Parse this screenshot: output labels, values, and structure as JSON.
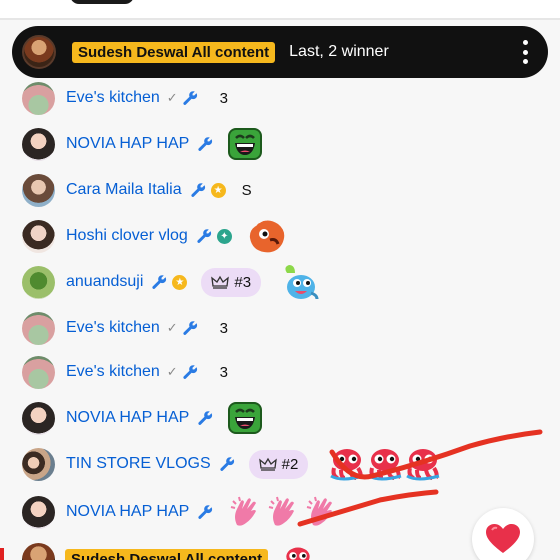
{
  "pinned": {
    "badge": "Sudesh Deswal All content",
    "text": "Last, 2 winner"
  },
  "messages": [
    {
      "author": "Eve's kitchen",
      "verified": true,
      "moderator": true,
      "member": null,
      "text": "3",
      "rank": null,
      "emote": null
    },
    {
      "author": "NOVIA HAP HAP",
      "verified": false,
      "moderator": true,
      "member": null,
      "text": "",
      "rank": null,
      "emote": "green-laughing-face-emote"
    },
    {
      "author": "Cara Maila Italia",
      "verified": false,
      "moderator": true,
      "member": "gold-member-badge",
      "text": "S",
      "rank": null,
      "emote": null
    },
    {
      "author": "Hoshi clover vlog",
      "verified": false,
      "moderator": true,
      "member": "teal-member-badge",
      "text": "",
      "rank": null,
      "emote": "orange-blob-emote"
    },
    {
      "author": "anuandsuji",
      "verified": false,
      "moderator": true,
      "member": "gold-member-badge",
      "text": "",
      "rank": "#3",
      "emote": "blue-dancing-emote"
    },
    {
      "author": "Eve's kitchen",
      "verified": true,
      "moderator": true,
      "member": null,
      "text": "3",
      "rank": null,
      "emote": null
    },
    {
      "author": "Eve's kitchen",
      "verified": true,
      "moderator": true,
      "member": null,
      "text": "3",
      "rank": null,
      "emote": null
    },
    {
      "author": "NOVIA HAP HAP",
      "verified": false,
      "moderator": true,
      "member": null,
      "text": "",
      "rank": null,
      "emote": "green-laughing-face-emote"
    },
    {
      "author": "TIN STORE VLOGS",
      "verified": false,
      "moderator": true,
      "member": null,
      "text": "",
      "rank": "#2",
      "emote": "red-octopus-emote x3"
    },
    {
      "author": "NOVIA HAP HAP",
      "verified": false,
      "moderator": true,
      "member": null,
      "text": "",
      "rank": null,
      "emote": "clapping-hands-emote x3"
    }
  ],
  "partial_bottom": {
    "badge": "Sudesh Deswal All content"
  },
  "icons": {
    "wrench": "wrench-icon",
    "verified": "check-icon",
    "crown": "crown-icon",
    "heart": "heart-icon",
    "menu": "kebab-menu-icon"
  },
  "colors": {
    "author": "#065fd4",
    "badge": "#f6b81d",
    "rank_pill": "#ecdcf6",
    "annotation": "#e53222"
  }
}
